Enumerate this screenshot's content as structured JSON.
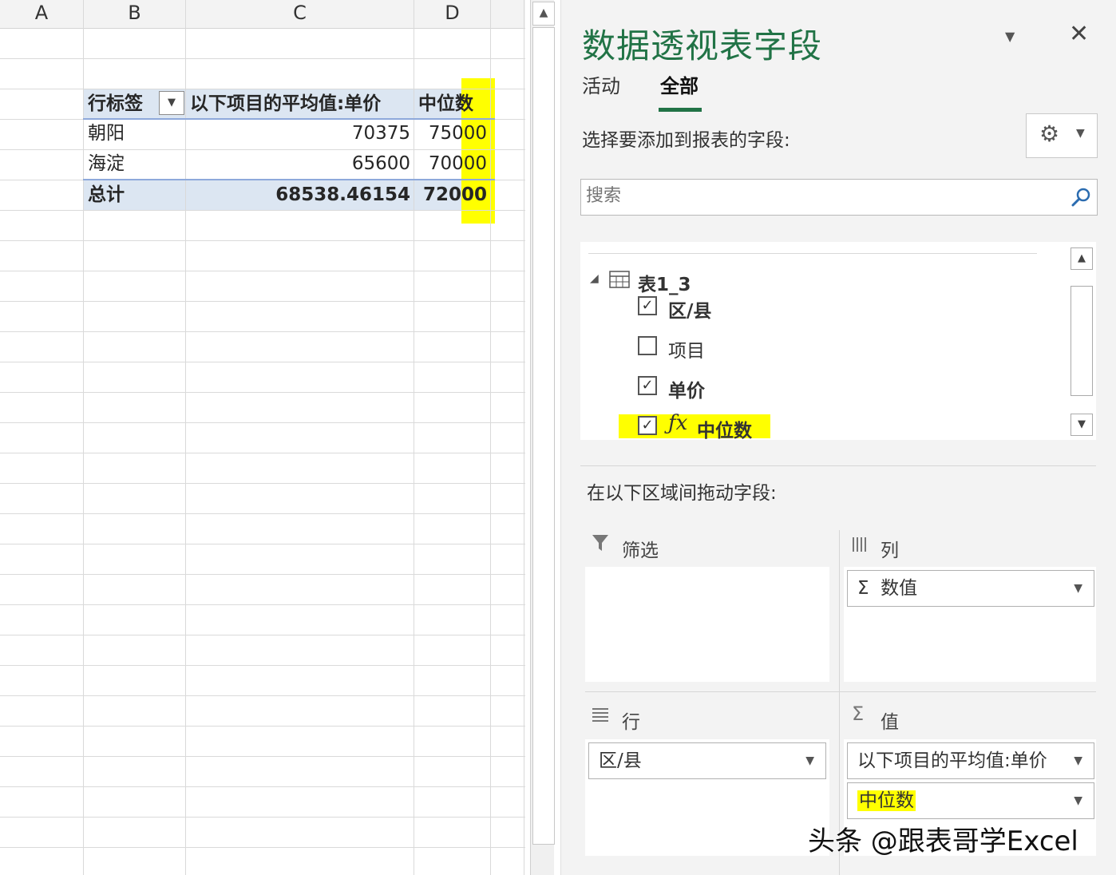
{
  "sheet": {
    "columns": [
      "A",
      "B",
      "C",
      "D"
    ],
    "pivot": {
      "header": {
        "row_label": "行标签",
        "measure1": "以下项目的平均值:单价",
        "measure2": "中位数"
      },
      "rows": [
        {
          "label": "朝阳",
          "v1": "70375",
          "v2": "75000"
        },
        {
          "label": "海淀",
          "v1": "65600",
          "v2": "70000"
        }
      ],
      "total": {
        "label": "总计",
        "v1": "68538.46154",
        "v2": "72000"
      }
    }
  },
  "pane": {
    "title": "数据透视表字段",
    "tabs": [
      "活动",
      "全部"
    ],
    "active_tab": "全部",
    "choose_label": "选择要添加到报表的字段:",
    "search_placeholder": "搜索",
    "table_name": "表1_3",
    "fields": [
      {
        "name": "区/县",
        "checked": true
      },
      {
        "name": "项目",
        "checked": false
      },
      {
        "name": "单价",
        "checked": true
      },
      {
        "name": "中位数",
        "checked": true
      }
    ],
    "drag_label": "在以下区域间拖动字段:",
    "areas": {
      "filter": {
        "title": "筛选",
        "items": []
      },
      "columns": {
        "title": "列",
        "items": [
          "数值"
        ]
      },
      "rows": {
        "title": "行",
        "items": [
          "区/县"
        ]
      },
      "values": {
        "title": "值",
        "items": [
          "以下项目的平均值:单价",
          "中位数"
        ]
      }
    }
  },
  "watermark": "头条 @跟表哥学Excel",
  "colors": {
    "accent": "#217346",
    "highlight": "#ffff00",
    "pivot_band": "#dce6f2"
  }
}
